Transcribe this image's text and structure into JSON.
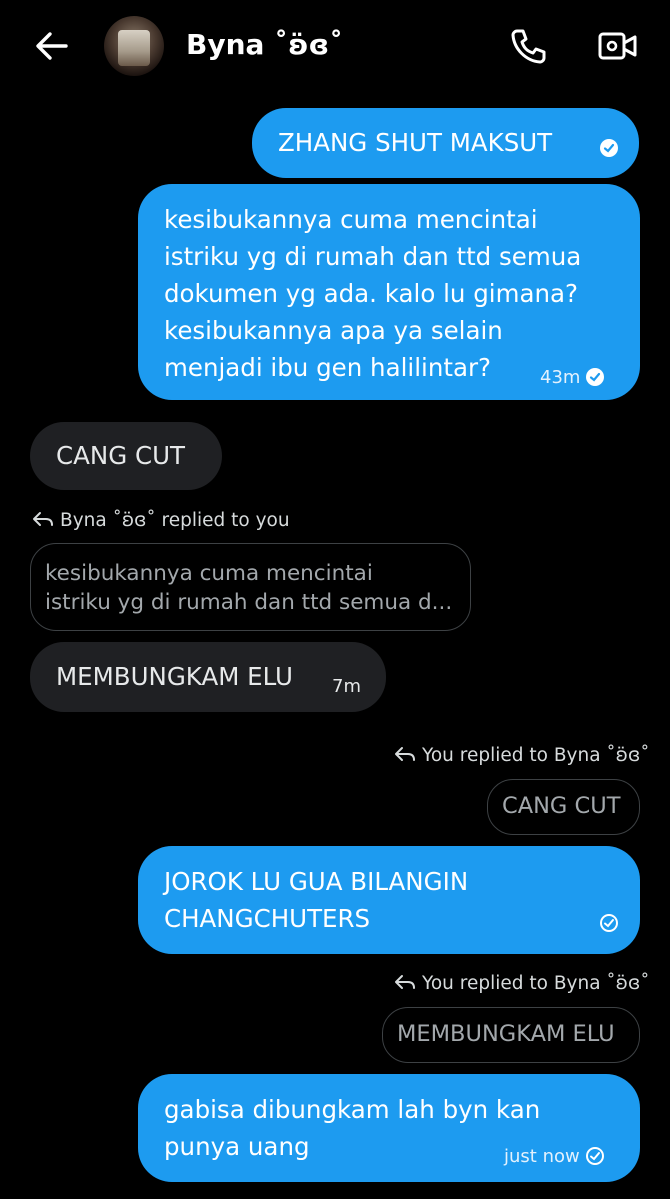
{
  "header": {
    "contact_name": "Byna ˚ʚ̈ɞ˚",
    "back_icon": "arrow-left-icon",
    "call_icon": "phone-icon",
    "video_icon": "video-camera-icon"
  },
  "messages": [
    {
      "direction": "out",
      "text": "ZHANG SHUT MAKSUT",
      "time": ""
    },
    {
      "direction": "out",
      "text": "kesibukannya cuma mencintai\nistriku yg di rumah dan ttd semua\ndokumen yg ada. kalo lu gimana?\nkesibukannya apa ya selain\nmenjadi ibu gen halilintar?",
      "time": "43m"
    },
    {
      "direction": "in",
      "text": "CANG CUT",
      "time": ""
    },
    {
      "direction": "in",
      "reply_label": "Byna ˚ʚ̈ɞ˚ replied to you",
      "quoted": "kesibukannya cuma mencintai\nistriku yg di rumah dan ttd semua d...",
      "text": "MEMBUNGKAM ELU",
      "time": "7m"
    },
    {
      "direction": "out",
      "reply_label": "You replied to Byna ˚ʚ̈ɞ˚",
      "quoted": "CANG CUT",
      "text": "JOROK LU GUA BILANGIN\nCHANGCHUTERS",
      "time": ""
    },
    {
      "direction": "out",
      "reply_label": "You replied to Byna ˚ʚ̈ɞ˚",
      "quoted": "MEMBUNGKAM ELU",
      "text": "gabisa dibungkam lah byn kan\npunya uang",
      "time": "just now"
    }
  ],
  "colors": {
    "outgoing": "#1d9bf0",
    "incoming": "#1f2023",
    "background": "#000000"
  }
}
